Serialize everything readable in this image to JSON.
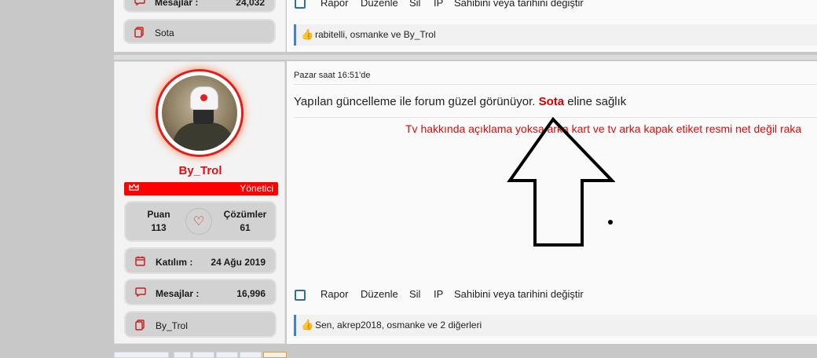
{
  "top_post": {
    "messages_label": "Mesajlar :",
    "messages_value": "24,032",
    "signature_name": "Sota",
    "actions": [
      "Rapor",
      "Düzenle",
      "Sil",
      "IP",
      "Sahibini veya tarihini değiştir"
    ],
    "likes_text": "rabitelli, osmanke ve By_Trol"
  },
  "post": {
    "username": "By_Trol",
    "role": "Yönetici",
    "stats": {
      "points_label": "Puan",
      "points_value": "113",
      "solutions_label": "Çözümler",
      "solutions_value": "61"
    },
    "joined_label": "Katılım :",
    "joined_value": "24 Ağu 2019",
    "messages_label": "Mesajlar :",
    "messages_value": "16,996",
    "signature_name": "By_Trol",
    "time": "Pazar saat 16:51'de",
    "body_pre": "Yapılan güncelleme ile forum güzel görünüyor.",
    "body_mention": "Sota",
    "body_post": "eline sağlık",
    "quote_text": "Tv hakkında açıklama yoksa arka kart ve tv arka kapak etiket resmi net değil raka",
    "actions": [
      "Rapor",
      "Düzenle",
      "Sil",
      "IP",
      "Sahibini veya tarihini değiştir"
    ],
    "likes_text": "Sen, akrep2018, osmanke ve 2 diğerleri"
  },
  "colors": {
    "accent_red": "#ff0000",
    "username_red": "#e30f0f",
    "link_blue": "#2a6eb6"
  },
  "icons": {
    "messages": "speech-bubble-icon",
    "signature": "copy-icon",
    "calendar": "calendar-icon",
    "crown": "crown-icon",
    "heart": "heart-icon",
    "like": "thumbs-up-icon",
    "checkbox": "checkbox-icon"
  }
}
